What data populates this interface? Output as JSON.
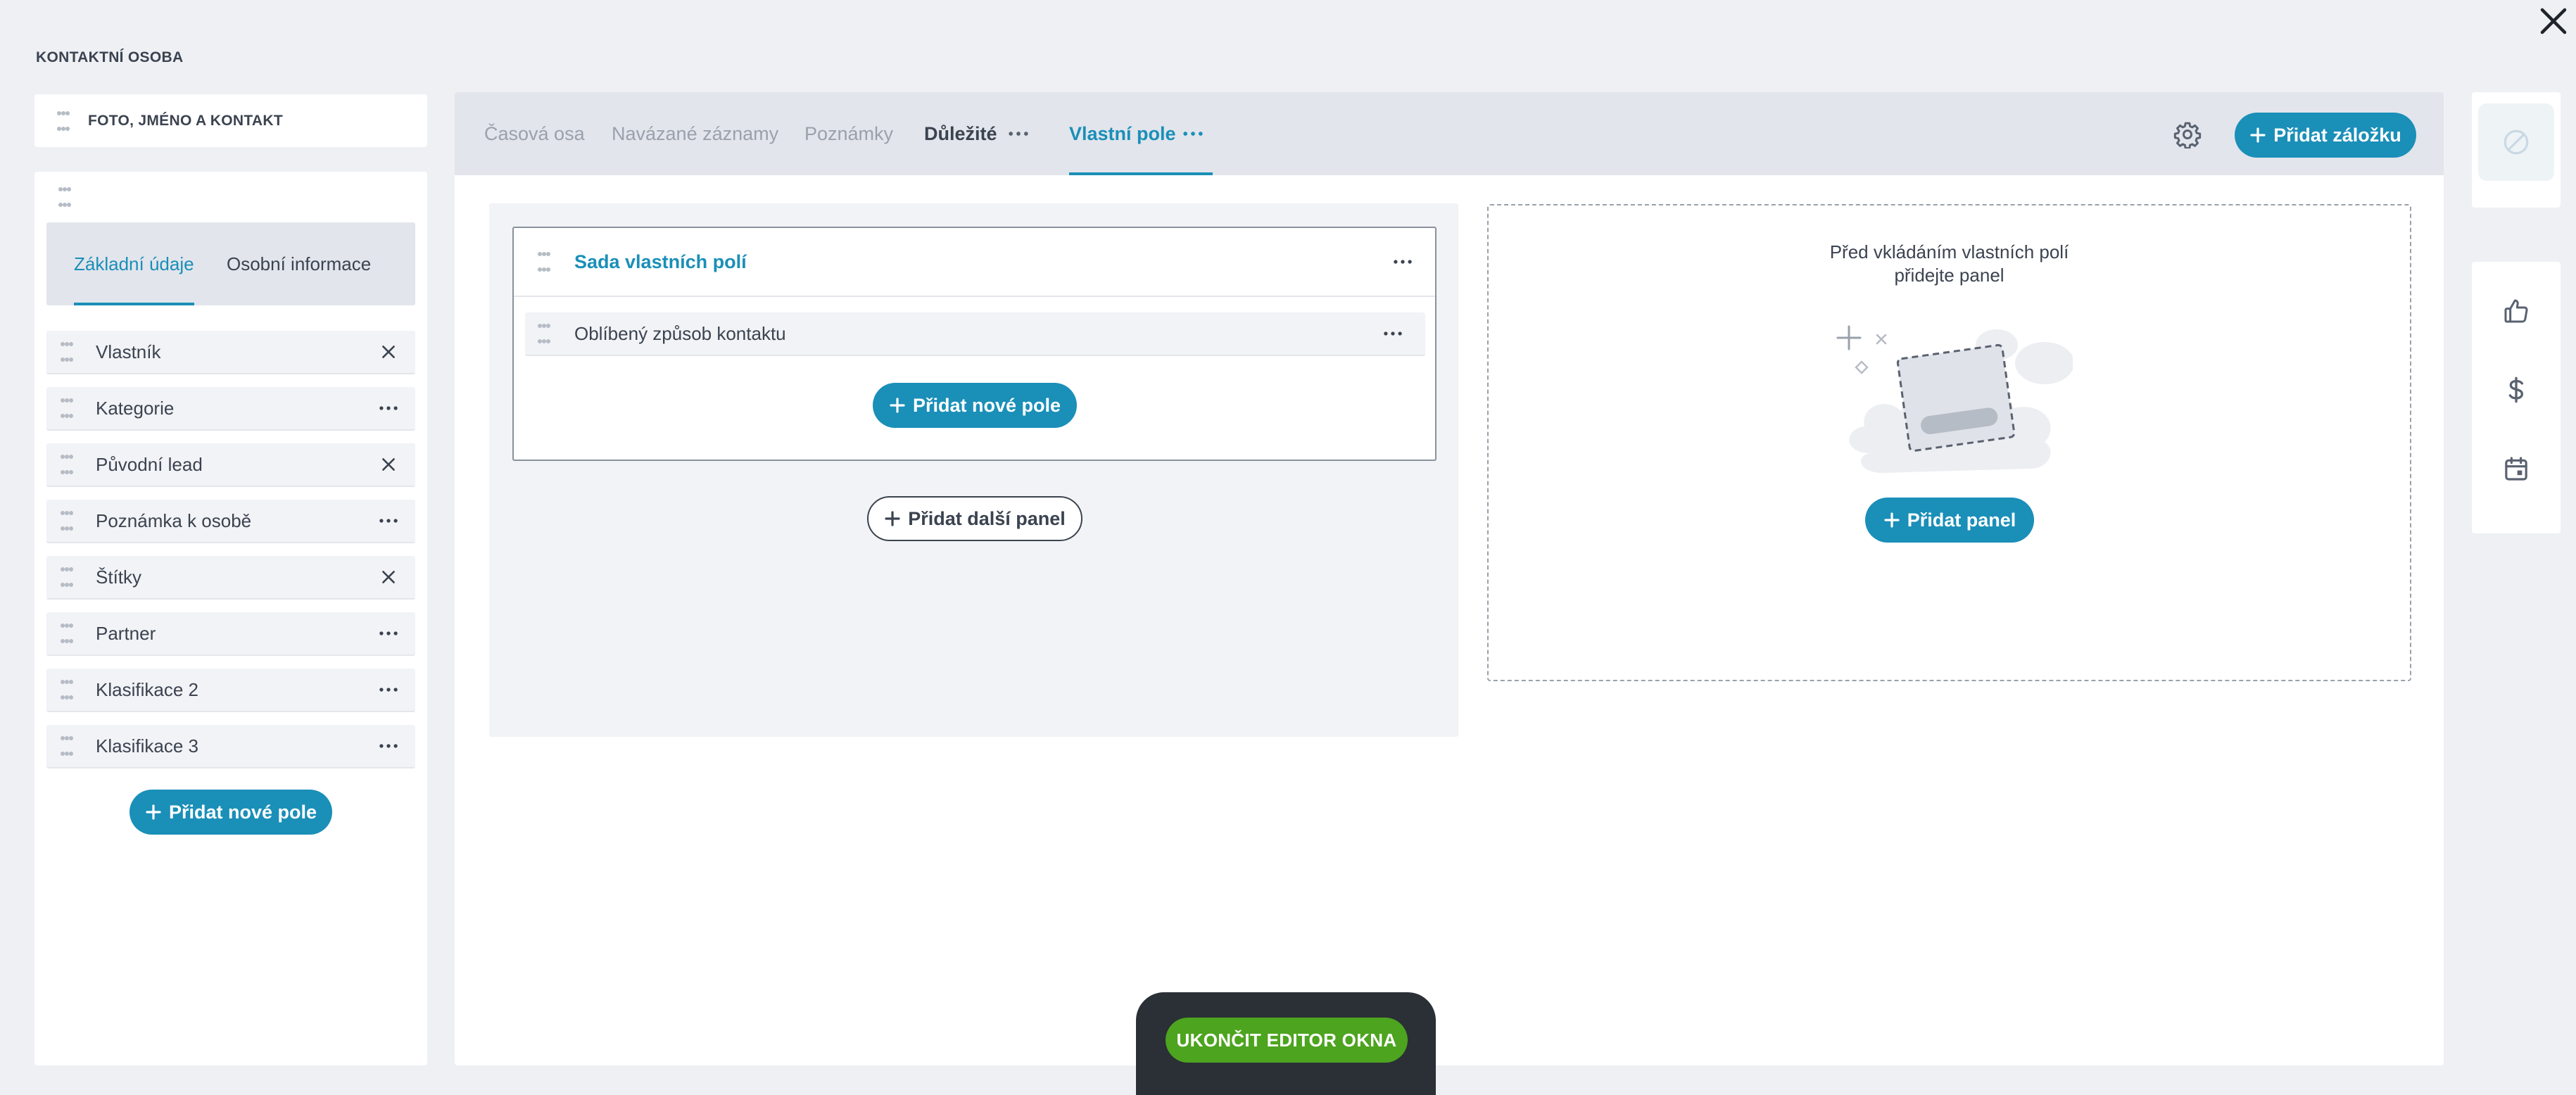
{
  "window": {
    "section_title": "KONTAKTNÍ OSOBA"
  },
  "left": {
    "top_card_label": "FOTO, JMÉNO A KONTAKT",
    "tabs": [
      {
        "label": "Základní údaje",
        "active": true
      },
      {
        "label": "Osobní informace",
        "active": false
      }
    ],
    "fields": [
      {
        "label": "Vlastník",
        "action": "remove"
      },
      {
        "label": "Kategorie",
        "action": "more"
      },
      {
        "label": "Původní lead",
        "action": "remove"
      },
      {
        "label": "Poznámka k osobě",
        "action": "more"
      },
      {
        "label": "Štítky",
        "action": "remove"
      },
      {
        "label": "Partner",
        "action": "more"
      },
      {
        "label": "Klasifikace 2",
        "action": "more"
      },
      {
        "label": "Klasifikace 3",
        "action": "more"
      }
    ],
    "add_field_label": "Přidat nové pole"
  },
  "main": {
    "tabs": [
      {
        "label": "Časová osa",
        "style": "muted"
      },
      {
        "label": "Navázané záznamy",
        "style": "muted"
      },
      {
        "label": "Poznámky",
        "style": "muted"
      },
      {
        "label": "Důležité",
        "style": "dark"
      },
      {
        "label": "Vlastní pole",
        "style": "active"
      }
    ],
    "add_tab_label": "Přidat záložku",
    "field_set": {
      "title": "Sada vlastních polí",
      "fields": [
        {
          "label": "Oblíbený způsob kontaktu"
        }
      ],
      "add_field_label": "Přidat nové pole"
    },
    "add_panel_outline_label": "Přidat další panel",
    "empty_zone": {
      "line1": "Před vkládáním vlastních polí",
      "line2": "přidejte panel",
      "add_panel_label": "Přidat panel"
    }
  },
  "right_sidebar": {
    "icons": [
      "ban-icon",
      "thumbs-up-icon",
      "dollar-icon",
      "calendar-icon"
    ]
  },
  "editor_bar": {
    "exit_label": "UKONČIT EDITOR OKNA"
  },
  "colors": {
    "accent": "#1a8fb8",
    "exit_green": "#4da41f",
    "header_gray": "#e2e5ec",
    "background": "#eef0f4"
  }
}
